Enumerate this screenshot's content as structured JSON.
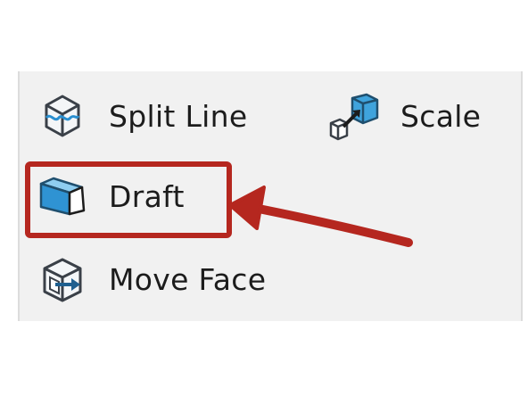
{
  "toolbar": {
    "items": [
      {
        "label": "Split Line",
        "icon": "split-line-icon"
      },
      {
        "label": "Scale",
        "icon": "scale-icon"
      },
      {
        "label": "Draft",
        "icon": "draft-icon"
      },
      {
        "label": "Move Face",
        "icon": "move-face-icon"
      }
    ]
  },
  "annotation": {
    "highlight_color": "#b5271f",
    "arrow_color": "#b5271f",
    "highlighted_item": "Draft"
  }
}
